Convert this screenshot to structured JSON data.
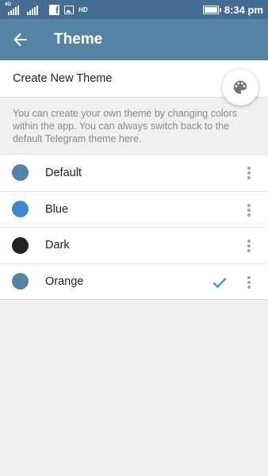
{
  "status_bar": {
    "network_label": "4G",
    "hd_label": "HD",
    "time": "8:34 pm",
    "icons": [
      "signal-icon",
      "signal-icon",
      "facebook-icon",
      "gallery-icon",
      "battery-icon"
    ]
  },
  "app_bar": {
    "title": "Theme",
    "back_icon": "back-arrow-icon"
  },
  "create_theme": {
    "label": "Create New Theme",
    "action_icon": "palette-icon"
  },
  "info_text": "You can create your own theme by changing colors within the app. You can always switch back to the default Telegram theme here.",
  "themes": [
    {
      "name": "Default",
      "color": "#5682a3",
      "selected": false
    },
    {
      "name": "Blue",
      "color": "#3b8acb",
      "selected": false
    },
    {
      "name": "Dark",
      "color": "#222222",
      "selected": false
    },
    {
      "name": "Orange",
      "color": "#5682a3",
      "selected": true
    }
  ],
  "colors": {
    "status_bar": "#456d93",
    "app_bar": "#5682a3",
    "accent_check": "#3b8acb",
    "background": "#f0f0f0"
  }
}
